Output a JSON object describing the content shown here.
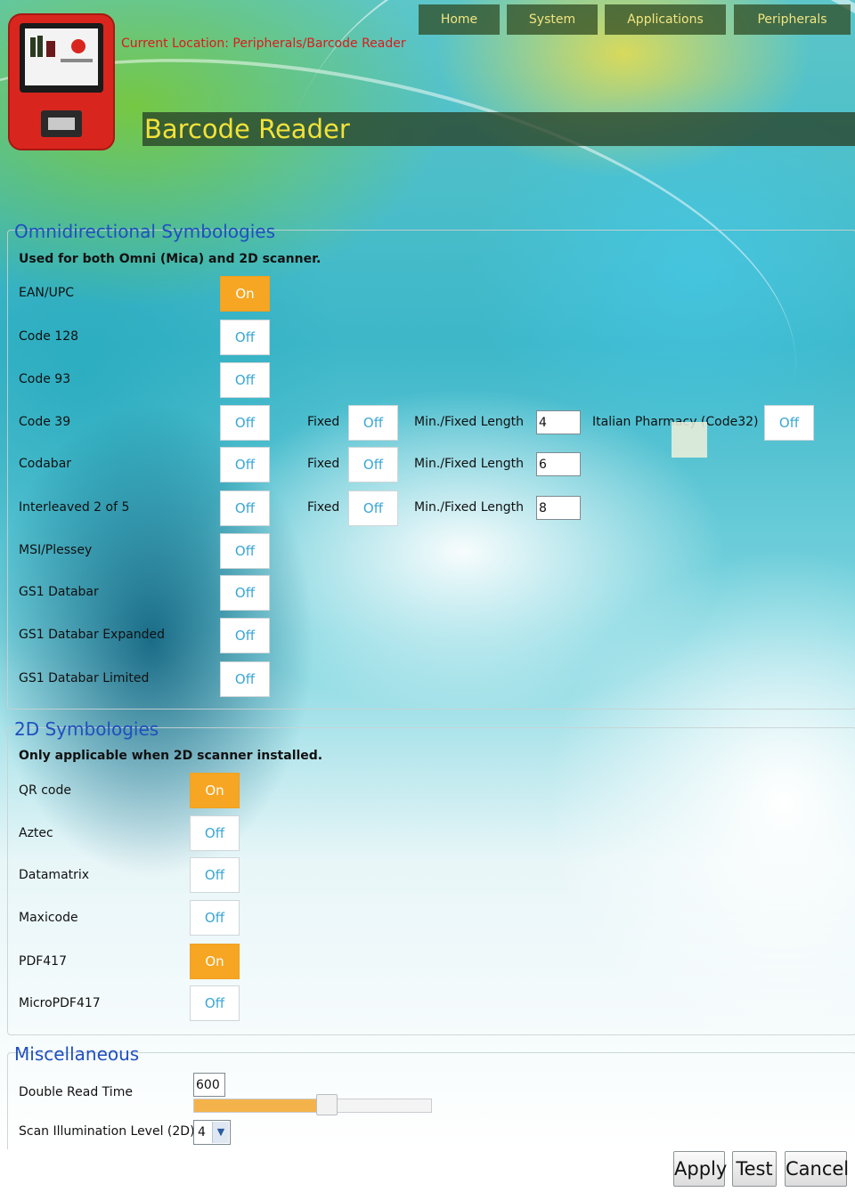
{
  "header": {
    "location": "Current Location: Peripherals/Barcode Reader",
    "nav": [
      "Home",
      "System",
      "Applications",
      "Peripherals"
    ],
    "page_title": "Barcode Reader"
  },
  "omni": {
    "legend": "Omnidirectional Symbologies",
    "note": "Used for both Omni (Mica) and 2D scanner.",
    "rows": [
      {
        "label": "EAN/UPC",
        "state": "On"
      },
      {
        "label": "Code 128",
        "state": "Off"
      },
      {
        "label": "Code 93",
        "state": "Off"
      },
      {
        "label": "Code 39",
        "state": "Off",
        "fixed_label": "Fixed",
        "fixed_state": "Off",
        "length_label": "Min./Fixed Length",
        "length": "4"
      },
      {
        "label": "Codabar",
        "state": "Off",
        "fixed_label": "Fixed",
        "fixed_state": "Off",
        "length_label": "Min./Fixed Length",
        "length": "6"
      },
      {
        "label": "Interleaved 2 of 5",
        "state": "Off",
        "fixed_label": "Fixed",
        "fixed_state": "Off",
        "length_label": "Min./Fixed Length",
        "length": "8"
      },
      {
        "label": "MSI/Plessey",
        "state": "Off"
      },
      {
        "label": "GS1 Databar",
        "state": "Off"
      },
      {
        "label": "GS1 Databar Expanded",
        "state": "Off"
      },
      {
        "label": "GS1 Databar Limited",
        "state": "Off"
      }
    ],
    "italian_label": "Italian Pharmacy (Code32)",
    "italian_state": "Off"
  },
  "twod": {
    "legend": "2D Symbologies",
    "note": "Only applicable when 2D scanner installed.",
    "rows": [
      {
        "label": "QR code",
        "state": "On"
      },
      {
        "label": "Aztec",
        "state": "Off"
      },
      {
        "label": "Datamatrix",
        "state": "Off"
      },
      {
        "label": "Maxicode",
        "state": "Off"
      },
      {
        "label": "PDF417",
        "state": "On"
      },
      {
        "label": "MicroPDF417",
        "state": "Off"
      }
    ]
  },
  "misc": {
    "legend": "Miscellaneous",
    "double_read_label": "Double Read Time",
    "double_read_value": "600",
    "double_read_fraction": 0.52,
    "illumination_label": "Scan Illumination Level (2D)",
    "illumination_value": "4"
  },
  "actions": {
    "apply": "Apply",
    "test": "Test",
    "cancel": "Cancel"
  },
  "colors": {
    "on": "#f6a623",
    "off_text": "#3aa6d6",
    "legend": "#1f4fbf",
    "title": "#f2e23a",
    "location": "#d81c1c"
  }
}
